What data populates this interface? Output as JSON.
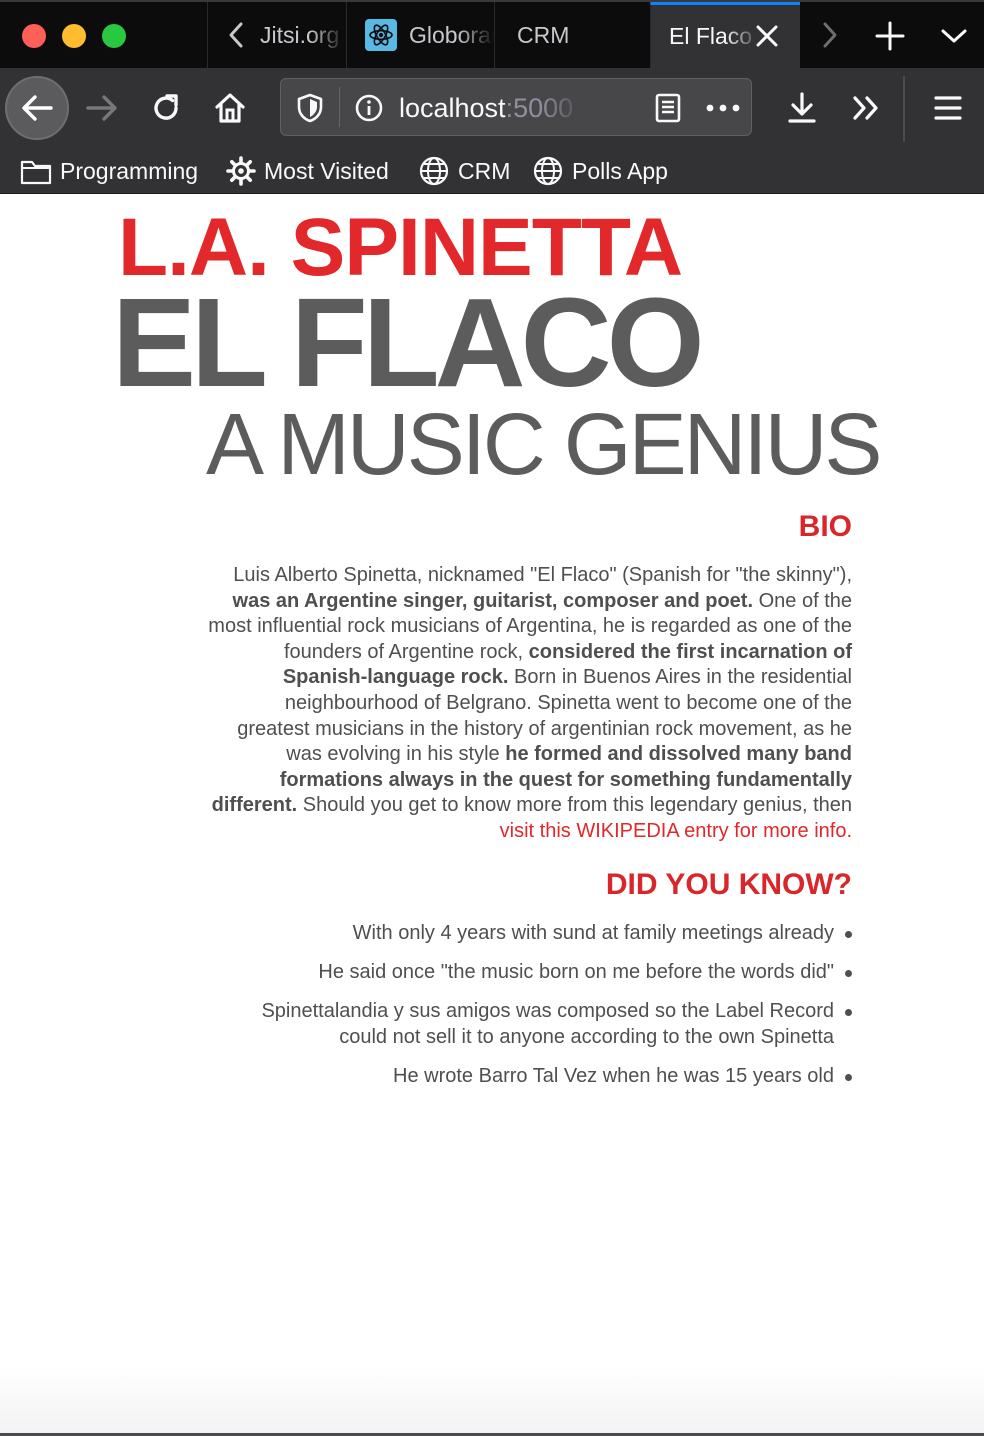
{
  "browser": {
    "tabs": [
      {
        "label": "Jitsi.org"
      },
      {
        "label": "Globorama"
      },
      {
        "label": "CRM"
      },
      {
        "label": "El Flaco"
      }
    ],
    "url": {
      "host": "localhost",
      "port": ":5000"
    },
    "bookmarks": [
      {
        "label": "Programming",
        "icon": "folder-icon"
      },
      {
        "label": "Most Visited",
        "icon": "gear-icon"
      },
      {
        "label": "CRM",
        "icon": "globe-icon"
      },
      {
        "label": "Polls App",
        "icon": "globe-icon"
      }
    ],
    "accent_color": "#0a84ff"
  },
  "page": {
    "heading_name": "L.A. SPINETTA",
    "heading_nickname": "EL FLACO",
    "heading_tagline": "A MUSIC GENIUS",
    "bio_title": "BIO",
    "bio": {
      "p1": "Luis Alberto Spinetta, nicknamed \"El Flaco\" (Spanish for \"the skinny\"),",
      "b1": "was an Argentine singer, guitarist, composer and poet.",
      "p2": "One of the most influential rock musicians of Argentina, he is regarded as one of the founders of Argentine rock,",
      "b2": "considered the first incarnation of Spanish-language rock.",
      "p3": "Born in Buenos Aires in the residential neighbourhood of Belgrano. Spinetta went to become one of the greatest musicians in the history of argentinian rock movement, as he was evolving in his style",
      "b3": "he formed and dissolved many band formations always in the quest for something fundamentally different.",
      "p4": "Should you get to know more from this legendary genius, then",
      "link": "visit this WIKIPEDIA entry for more info."
    },
    "facts_title": "DID YOU KNOW?",
    "facts": [
      "With only 4 years with sund at family meetings already",
      "He said once \"the music born on me before the words did\"",
      "Spinettalandia y sus amigos was composed so the Label Record could not sell it to anyone according to the own Spinetta",
      "He wrote Barro Tal Vez when he was 15 years old"
    ],
    "colors": {
      "accent_red": "#e2282a",
      "heading_gray": "#5c5c5c",
      "text_gray": "#4f4f4f"
    }
  }
}
